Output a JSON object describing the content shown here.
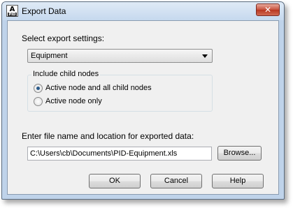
{
  "window": {
    "title": "Export Data",
    "app_icon_letters": "A",
    "app_icon_sub": "PID",
    "close_glyph": "✕"
  },
  "settings": {
    "label": "Select export settings:",
    "selected": "Equipment"
  },
  "child_nodes": {
    "legend": "Include child nodes",
    "options": [
      {
        "label": "Active node and all child nodes",
        "checked": true
      },
      {
        "label": "Active node only",
        "checked": false
      }
    ]
  },
  "file": {
    "label": "Enter file name and location for exported data:",
    "value": "C:\\Users\\cb\\Documents\\PID-Equipment.xls",
    "browse_label": "Browse..."
  },
  "buttons": {
    "ok": "OK",
    "cancel": "Cancel",
    "help": "Help"
  },
  "icons": {
    "app": "autocad-pid-icon",
    "close": "close-icon",
    "dropdown": "chevron-down-icon"
  }
}
